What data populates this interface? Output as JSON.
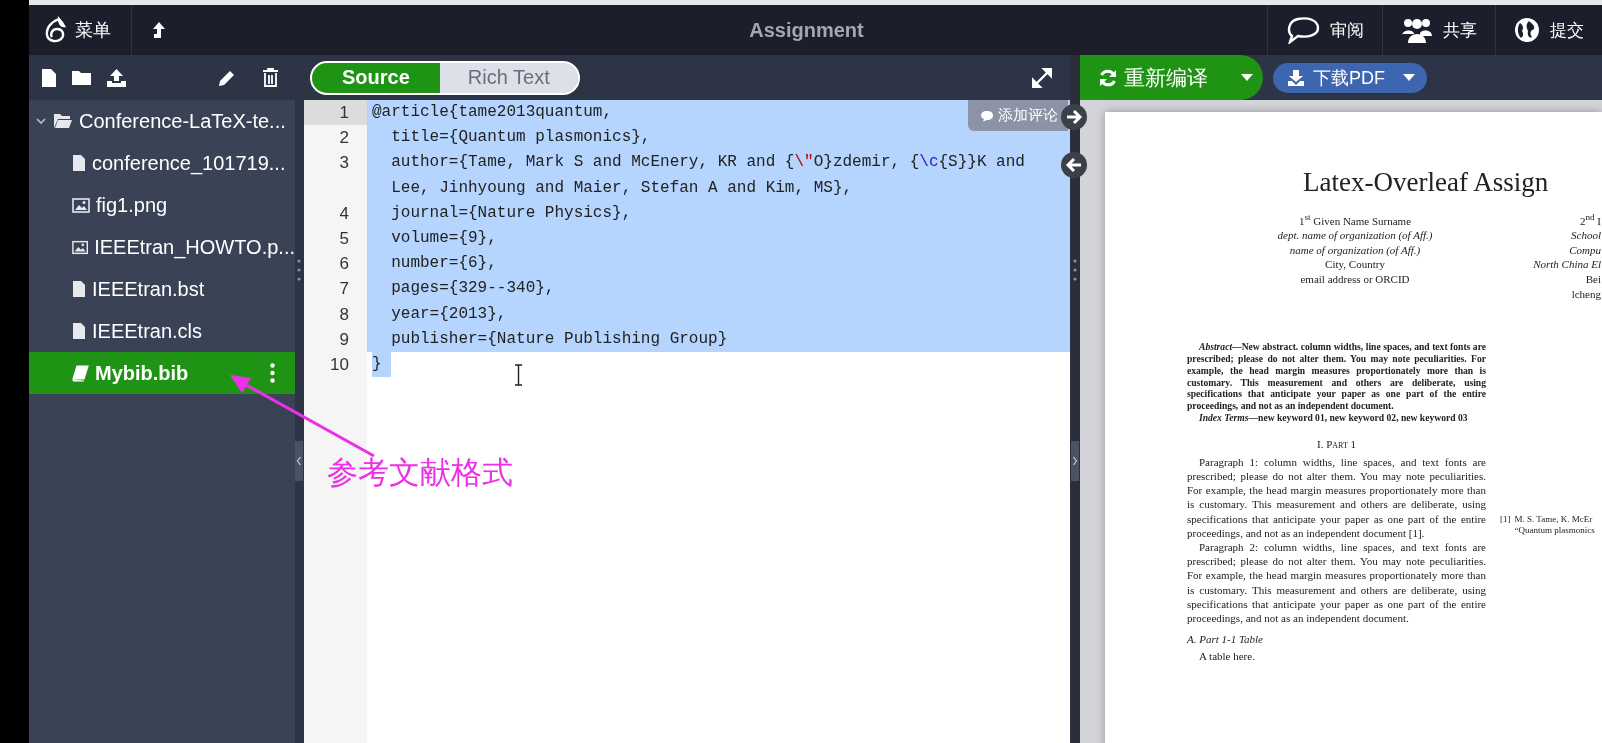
{
  "top_bar": {
    "menu_label": "菜单",
    "title": "Assignment",
    "actions": [
      {
        "label": "审阅",
        "kind": "review"
      },
      {
        "label": "共享",
        "kind": "share"
      },
      {
        "label": "提交",
        "kind": "submit"
      }
    ]
  },
  "file_tree": {
    "items": [
      {
        "label": "Conference-LaTeX-te...",
        "kind": "folder",
        "expanded": true,
        "selected": false,
        "children": [
          {
            "label": "conference_101719...",
            "kind": "file",
            "selected": false
          },
          {
            "label": "fig1.png",
            "kind": "image",
            "selected": false
          },
          {
            "label": "IEEEtran_HOWTO.p...",
            "kind": "image",
            "selected": false
          },
          {
            "label": "IEEEtran.bst",
            "kind": "file",
            "selected": false
          },
          {
            "label": "IEEEtran.cls",
            "kind": "file",
            "selected": false
          },
          {
            "label": "Mybib.bib",
            "kind": "bib",
            "selected": true
          }
        ]
      }
    ]
  },
  "editor_modes": [
    {
      "label": "Source",
      "selected": true
    },
    {
      "label": "Rich Text",
      "selected": false
    }
  ],
  "editor": {
    "comment_button": "添加评论",
    "lines": [
      {
        "number": "1",
        "active": true,
        "selected": true,
        "partial": false,
        "segments": [
          {
            "text": "@article{tame2013quantum,",
            "kind": "plain"
          }
        ]
      },
      {
        "number": "2",
        "active": false,
        "selected": true,
        "partial": false,
        "segments": [
          {
            "text": "  title={Quantum plasmonics},",
            "kind": "plain"
          }
        ]
      },
      {
        "number": "3",
        "active": false,
        "selected": true,
        "partial": false,
        "segments": [
          {
            "text": "  author={Tame, Mark S and McEnery, KR and {",
            "kind": "plain"
          },
          {
            "text": "\\\"",
            "kind": "escape"
          },
          {
            "text": "O}zdemir, {",
            "kind": "plain"
          },
          {
            "text": "\\c",
            "kind": "command"
          },
          {
            "text": "{S}}K and Lee, Jinhyoung and Maier, Stefan A and Kim, MS},",
            "kind": "plain"
          }
        ]
      },
      {
        "number": "4",
        "active": false,
        "selected": true,
        "partial": false,
        "segments": [
          {
            "text": "  journal={Nature Physics},",
            "kind": "plain"
          }
        ]
      },
      {
        "number": "5",
        "active": false,
        "selected": true,
        "partial": false,
        "segments": [
          {
            "text": "  volume={9},",
            "kind": "plain"
          }
        ]
      },
      {
        "number": "6",
        "active": false,
        "selected": true,
        "partial": false,
        "segments": [
          {
            "text": "  number={6},",
            "kind": "plain"
          }
        ]
      },
      {
        "number": "7",
        "active": false,
        "selected": true,
        "partial": false,
        "segments": [
          {
            "text": "  pages={329--340},",
            "kind": "plain"
          }
        ]
      },
      {
        "number": "8",
        "active": false,
        "selected": true,
        "partial": false,
        "segments": [
          {
            "text": "  year={2013},",
            "kind": "plain"
          }
        ]
      },
      {
        "number": "9",
        "active": false,
        "selected": true,
        "partial": false,
        "segments": [
          {
            "text": "  publisher={Nature Publishing Group}",
            "kind": "plain"
          }
        ]
      },
      {
        "number": "10",
        "active": false,
        "selected": true,
        "partial": true,
        "segments": [
          {
            "text": "}",
            "kind": "plain"
          }
        ]
      }
    ]
  },
  "pdf_toolbar": {
    "recompile": "重新编译",
    "download": "下载PDF"
  },
  "pdf": {
    "title": "Latex-Overleaf Assign",
    "authors": [
      [
        "1$^{st}$ Given Name Surname",
        "*dept. name of organization (of Aff.)*",
        "*name of organization (of Aff.)*",
        "City, Country",
        "email address or ORCID"
      ],
      [
        "2$^{nd}$ I",
        "*School*",
        "*Compu*",
        "*North China El*",
        "Bei",
        "lcheng"
      ]
    ],
    "abstract": "*Abstract*—New abstract. column widths, line spaces, and text fonts are prescribed; please do not alter them. You may note peculiarities. For example, the head margin measures proportionately more than is customary. This measurement and others are deliberate, using specifications that anticipate your paper as one part of the entire proceedings, and not as an independent document.",
    "index_terms": "*Index Terms*—new keyword 01, new keyword 02, new keyword 03",
    "section": "I. Part 1",
    "paragraphs": [
      "Paragraph 1: column widths, line spaces, and text fonts are prescribed; please do not alter them. You may note peculiarities. For example, the head margin measures proportionately more than is customary. This measurement and others are deliberate, using specifications that anticipate your paper as one part of the entire proceedings, and not as an independent document [1].",
      "Paragraph 2: column widths, line spaces, and text fonts are prescribed; please do not alter them. You may note peculiarities. For example, the head margin measures proportionately more than is customary. This measurement and others are deliberate, using specifications that anticipate your paper as one part of the entire proceedings, and not as an independent document."
    ],
    "subsection": "A. Part 1-1 Table",
    "subsection_text": "A table here.",
    "references": [
      {
        "label": "[1]",
        "lines": [
          "M. S. Tame, K. McEr",
          "“Quantum plasmonics"
        ]
      }
    ]
  },
  "annotation": {
    "text": "参考文献格式"
  }
}
